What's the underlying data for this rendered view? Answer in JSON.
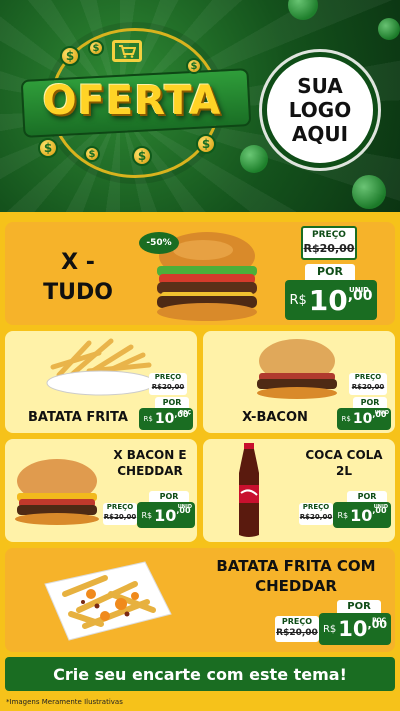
{
  "header": {
    "title": "OFERTA",
    "logo_lines": [
      "SUA",
      "LOGO",
      "AQUI"
    ],
    "coin_symbol": "$"
  },
  "featured": {
    "name_line1": "X -",
    "name_line2": "TUDO",
    "discount": "-50%",
    "old_label": "PREÇO",
    "old_price": "R$20,00",
    "por_label": "POR",
    "currency": "R$",
    "price_int": "10",
    "price_dec": ",00",
    "unit": "UNID"
  },
  "products": [
    {
      "name": "BATATA FRITA",
      "old_label": "PREÇO",
      "old_price": "R$20,00",
      "por_label": "POR",
      "currency": "R$",
      "price_int": "10",
      "price_dec": ",00",
      "unit": "POÇ"
    },
    {
      "name": "X-BACON",
      "old_label": "PREÇO",
      "old_price": "R$20,00",
      "por_label": "POR",
      "currency": "R$",
      "price_int": "10",
      "price_dec": ",00",
      "unit": "UNID"
    },
    {
      "name_line1": "X BACON E",
      "name_line2": "CHEDDAR",
      "old_label": "PREÇO",
      "old_price": "R$20,00",
      "por_label": "POR",
      "currency": "R$",
      "price_int": "10",
      "price_dec": ",00",
      "unit": "UNID"
    },
    {
      "name_line1": "COCA COLA",
      "name_line2": "2L",
      "old_label": "PREÇO",
      "old_price": "R$20,00",
      "por_label": "POR",
      "currency": "R$",
      "price_int": "10",
      "price_dec": ",00",
      "unit": "UNID"
    },
    {
      "name_line1": "BATATA FRITA COM",
      "name_line2": "CHEDDAR",
      "old_label": "PREÇO",
      "old_price": "R$20,00",
      "por_label": "POR",
      "currency": "R$",
      "price_int": "10",
      "price_dec": ",00",
      "unit": "POÇ"
    }
  ],
  "cta": "Crie seu encarte com este tema!",
  "footer_note": "*Imagens Meramente Ilustrativas",
  "colors": {
    "green": "#1a6d22",
    "yellow": "#f6c21a",
    "orange": "#f6b32a",
    "cream": "#fff2a8"
  }
}
